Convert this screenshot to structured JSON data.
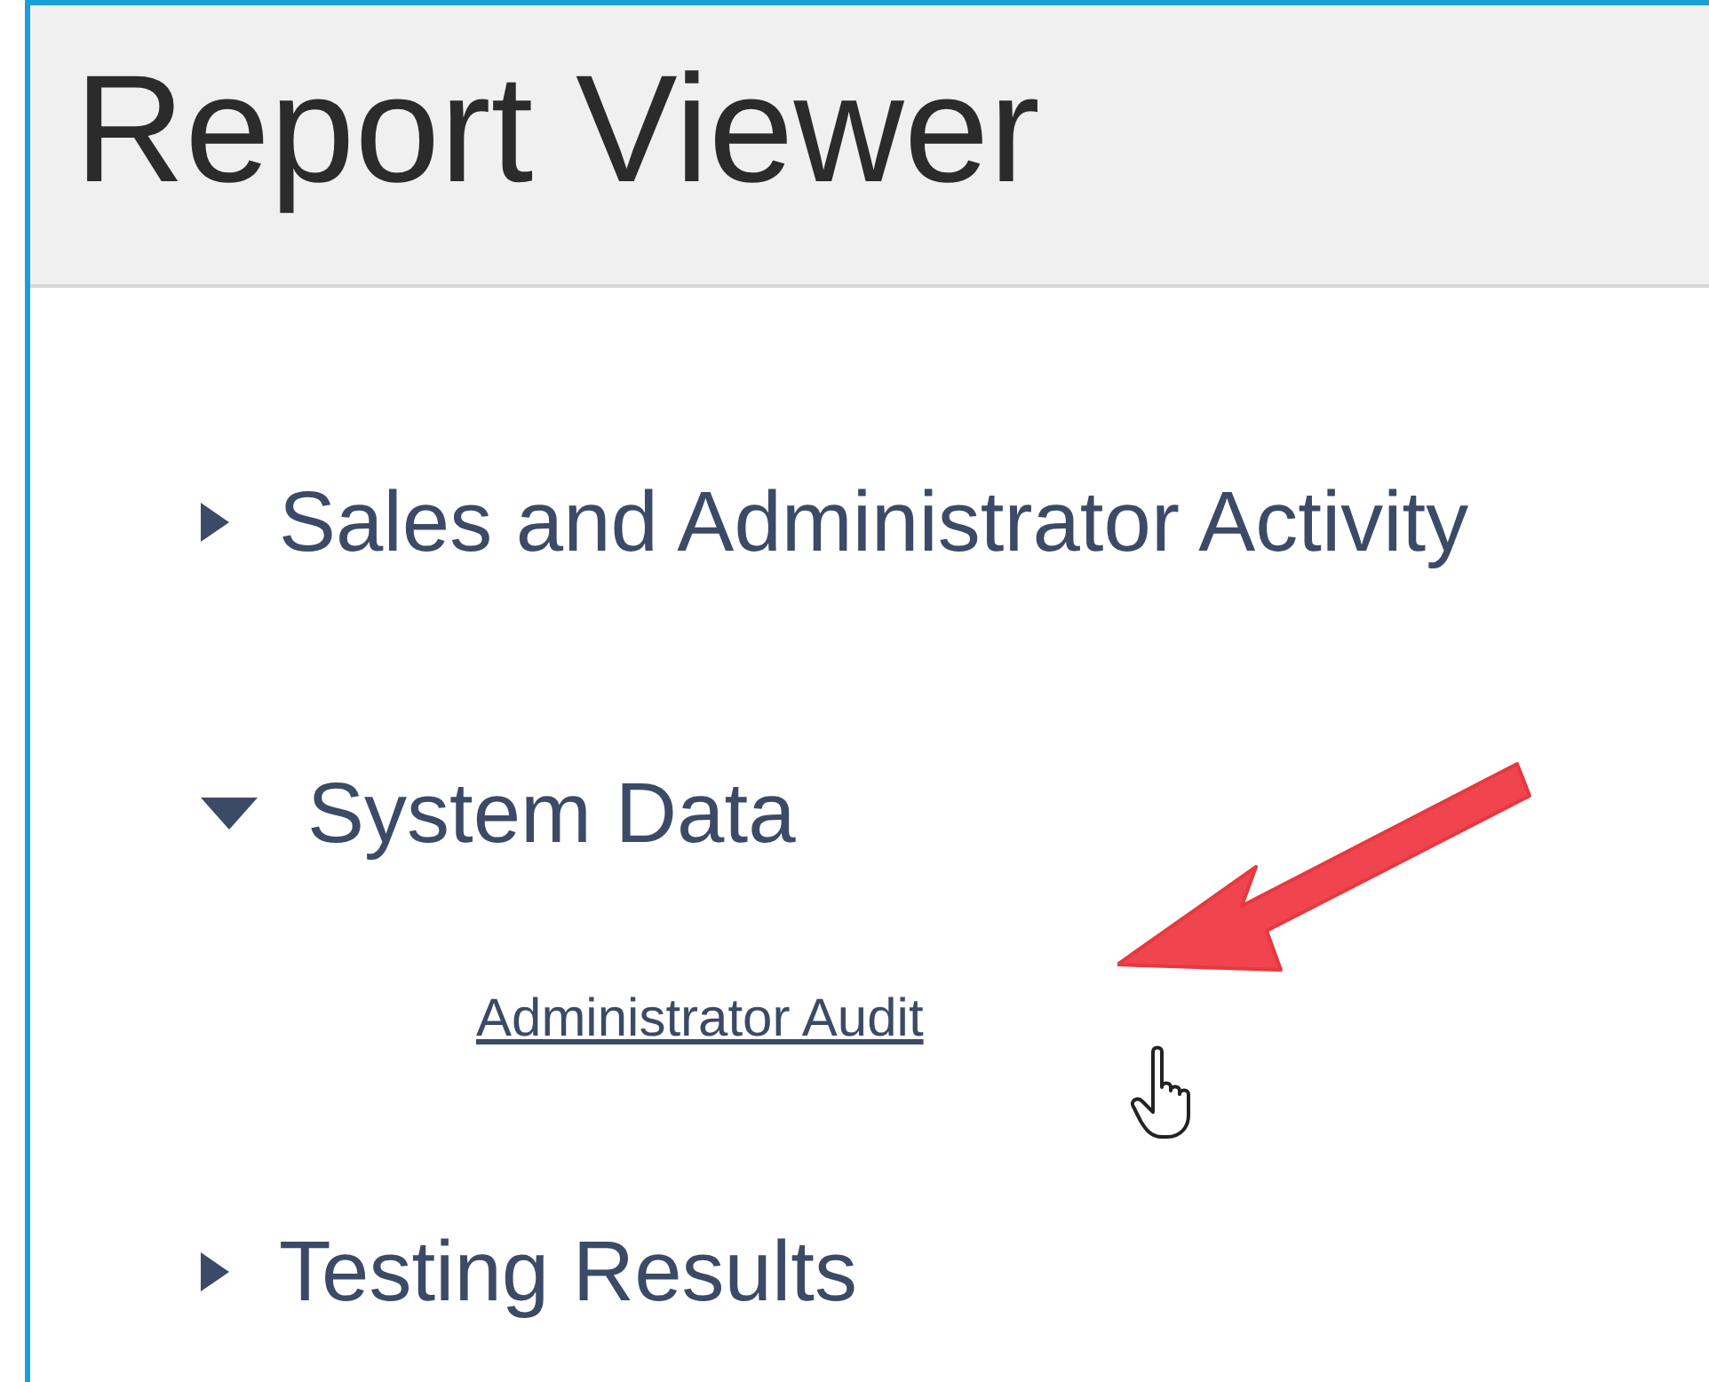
{
  "window": {
    "title": "Report Viewer"
  },
  "tree": [
    {
      "label": "Sales and Administrator Activity",
      "expanded": false
    },
    {
      "label": "System Data",
      "expanded": true,
      "children": [
        {
          "label": "Administrator Audit"
        }
      ]
    },
    {
      "label": "Testing Results",
      "expanded": false
    }
  ]
}
